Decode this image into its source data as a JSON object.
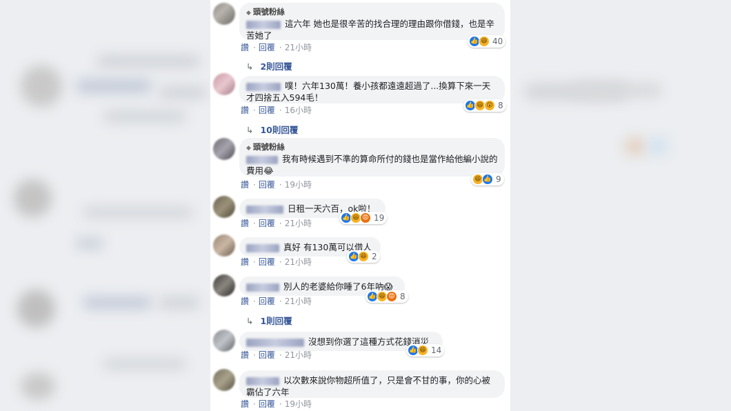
{
  "badge_label": "頭號粉絲",
  "actions": {
    "like": "讚",
    "reply": "回覆",
    "sep": "·"
  },
  "comments": [
    {
      "badge": true,
      "text": "這六年 她也是很辛苦的找合理的理由跟你借錢，也是辛苦她了",
      "time": "21小時",
      "reactions": [
        "like",
        "haha"
      ],
      "count": "40",
      "replies": "2則回覆"
    },
    {
      "badge": false,
      "text": "噗！六年130萬！養小孩都遠遠超過了...換算下來一天才四捨五入594毛！",
      "time": "16小時",
      "reactions": [
        "like",
        "haha",
        "wow"
      ],
      "count": "8",
      "replies": "10則回覆"
    },
    {
      "badge": true,
      "text": "我有時候遇到不準的算命所付的錢也是當作給他編小說的費用😂",
      "time": "19小時",
      "reactions": [
        "haha",
        "like"
      ],
      "count": "9",
      "replies": ""
    },
    {
      "badge": false,
      "text": "日租一天六百，ok啦！",
      "time": "21小時",
      "reactions": [
        "like",
        "haha",
        "angry"
      ],
      "count": "19",
      "replies": ""
    },
    {
      "badge": false,
      "text": "真好 有130萬可以借人",
      "time": "21小時",
      "reactions": [
        "like",
        "haha"
      ],
      "count": "2",
      "replies": ""
    },
    {
      "badge": false,
      "text": "別人的老婆給你睡了6年吶😱",
      "time": "21小時",
      "reactions": [
        "like",
        "haha",
        "angry"
      ],
      "count": "8",
      "replies": "1則回覆"
    },
    {
      "badge": false,
      "text": "沒想到你選了這種方式花錢消災",
      "time": "21小時",
      "reactions": [
        "like",
        "haha"
      ],
      "count": "14",
      "replies": ""
    },
    {
      "badge": false,
      "text": "以次數來說你物超所值了，只是會不甘的事，你的心被霸佔了六年",
      "time": "19小時",
      "reactions": [],
      "count": "",
      "replies": ""
    }
  ]
}
